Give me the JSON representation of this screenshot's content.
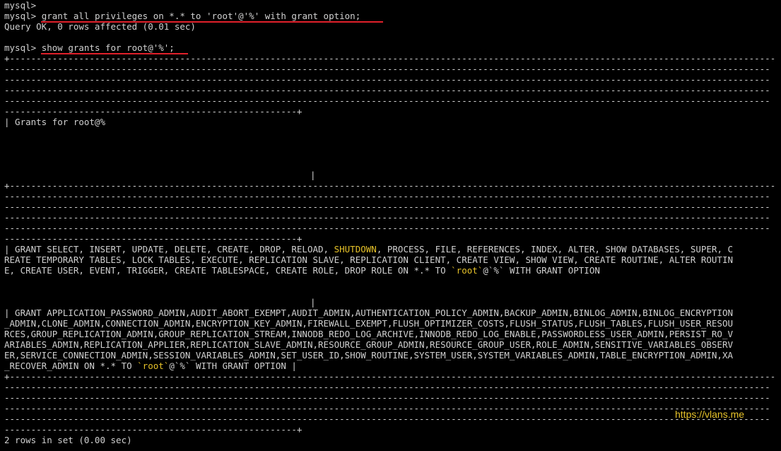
{
  "terminal": {
    "prompt_line_empty": "mysql>",
    "cmd1": {
      "prompt": "mysql> ",
      "text": "grant all privileges on *.* to 'root'@'%' with grant option;"
    },
    "result1": "Query OK, 0 rows affected (0.01 sec)",
    "cmd2": {
      "prompt": "mysql> ",
      "text": "show grants for root@'%';"
    },
    "border_top": "+------------------------------------------------------------------------------------------------------------------------------------------------",
    "dash_row": "------------------------------------------------------------------------------------------------------------------------------------------------",
    "border_end": "-------------------------------------------------------+",
    "header": "| Grants for root@%",
    "pipe": "|",
    "row1": {
      "a": "| GRANT SELECT, INSERT, UPDATE, DELETE, CREATE, DROP, RELOAD, ",
      "shutdown": "SHUTDOWN",
      "b": ", PROCESS, FILE, REFERENCES, INDEX, ALTER, SHOW DATABASES, SUPER, C",
      "line2": "REATE TEMPORARY TABLES, LOCK TABLES, EXECUTE, REPLICATION SLAVE, REPLICATION CLIENT, CREATE VIEW, SHOW VIEW, CREATE ROUTINE, ALTER ROUTIN",
      "line3a": "E, CREATE USER, EVENT, TRIGGER, CREATE TABLESPACE, CREATE ROLE, DROP ROLE ON *.* TO ",
      "root": "`root`",
      "at_pct": "@`%`",
      "line3b": " WITH GRANT OPTION"
    },
    "row2": {
      "line1": "| GRANT APPLICATION_PASSWORD_ADMIN,AUDIT_ABORT_EXEMPT,AUDIT_ADMIN,AUTHENTICATION_POLICY_ADMIN,BACKUP_ADMIN,BINLOG_ADMIN,BINLOG_ENCRYPTION",
      "line2": "_ADMIN,CLONE_ADMIN,CONNECTION_ADMIN,ENCRYPTION_KEY_ADMIN,FIREWALL_EXEMPT,FLUSH_OPTIMIZER_COSTS,FLUSH_STATUS,FLUSH_TABLES,FLUSH_USER_RESOU",
      "line3": "RCES,GROUP_REPLICATION_ADMIN,GROUP_REPLICATION_STREAM,INNODB_REDO_LOG_ARCHIVE,INNODB_REDO_LOG_ENABLE,PASSWORDLESS_USER_ADMIN,PERSIST_RO_V",
      "line4": "ARIABLES_ADMIN,REPLICATION_APPLIER,REPLICATION_SLAVE_ADMIN,RESOURCE_GROUP_ADMIN,RESOURCE_GROUP_USER,ROLE_ADMIN,SENSITIVE_VARIABLES_OBSERV",
      "line5": "ER,SERVICE_CONNECTION_ADMIN,SESSION_VARIABLES_ADMIN,SET_USER_ID,SHOW_ROUTINE,SYSTEM_USER,SYSTEM_VARIABLES_ADMIN,TABLE_ENCRYPTION_ADMIN,XA",
      "line6a": "_RECOVER_ADMIN ON *.* TO ",
      "root": "`root`",
      "at_pct": "@`%`",
      "line6b": " WITH GRANT OPTION |"
    },
    "footer": "2 rows in set (0.00 sec)",
    "watermark": "https://vlans.me"
  },
  "colors": {
    "background": "#000000",
    "text": "#d0d0d0",
    "highlight": "#e6c229",
    "underline": "#e0202a"
  }
}
